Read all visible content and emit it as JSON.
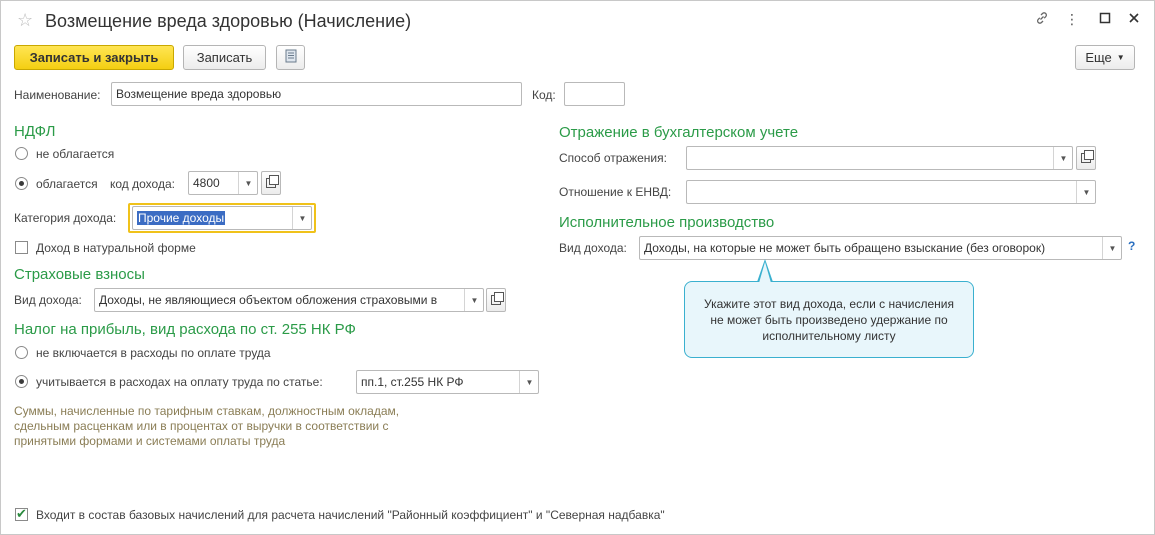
{
  "window": {
    "title": "Возмещение вреда здоровью (Начисление)"
  },
  "toolbar": {
    "save_close_label": "Записать и закрыть",
    "save_label": "Записать",
    "more_label": "Еще"
  },
  "header": {
    "name_label": "Наименование:",
    "name_value": "Возмещение вреда здоровью",
    "code_label": "Код:",
    "code_value": ""
  },
  "ndfl": {
    "title": "НДФЛ",
    "not_taxed_label": "не облагается",
    "taxed_label": "облагается",
    "income_code_label": "код дохода:",
    "income_code_value": "4800",
    "income_category_label": "Категория дохода:",
    "income_category_value": "Прочие доходы",
    "in_kind_label": "Доход в натуральной форме",
    "selected": "taxed",
    "in_kind_checked": false
  },
  "insurance": {
    "title": "Страховые взносы",
    "income_type_label": "Вид дохода:",
    "income_type_value": "Доходы, не являющиеся объектом обложения страховыми в"
  },
  "profit_tax": {
    "title": "Налог на прибыль, вид расхода по ст. 255 НК РФ",
    "not_included_label": "не включается в расходы по оплате труда",
    "included_label": "учитывается в расходах на оплату труда по статье:",
    "article_value": "пп.1, ст.255 НК РФ",
    "selected": "included",
    "note": "Суммы, начисленные по тарифным ставкам, должностным окладам, сдельным расценкам или в процентах от выручки в соответствии с принятыми формами и системами оплаты труда"
  },
  "accounting": {
    "title": "Отражение в бухгалтерском учете",
    "method_label": "Способ отражения:",
    "method_value": "",
    "envd_label": "Отношение к ЕНВД:",
    "envd_value": ""
  },
  "enforcement": {
    "title": "Исполнительное производство",
    "income_type_label": "Вид дохода:",
    "income_type_value": "Доходы, на которые не может быть обращено взыскание (без оговорок)",
    "help_label": "?"
  },
  "tooltip": {
    "text": "Укажите этот вид дохода, если с начисления не может быть произведено удержание по исполнительному листу"
  },
  "footer": {
    "base_accruals_label": "Входит в состав базовых начислений для расчета начислений \"Районный коэффициент\" и \"Северная надбавка\"",
    "base_accruals_checked": true
  },
  "colors": {
    "section_title": "#2b9b48",
    "primary_button": "#f4cf12",
    "tooltip_border": "#3ab0cf",
    "tooltip_bg": "#e8f6fb",
    "highlight_border": "#f0c21a"
  }
}
